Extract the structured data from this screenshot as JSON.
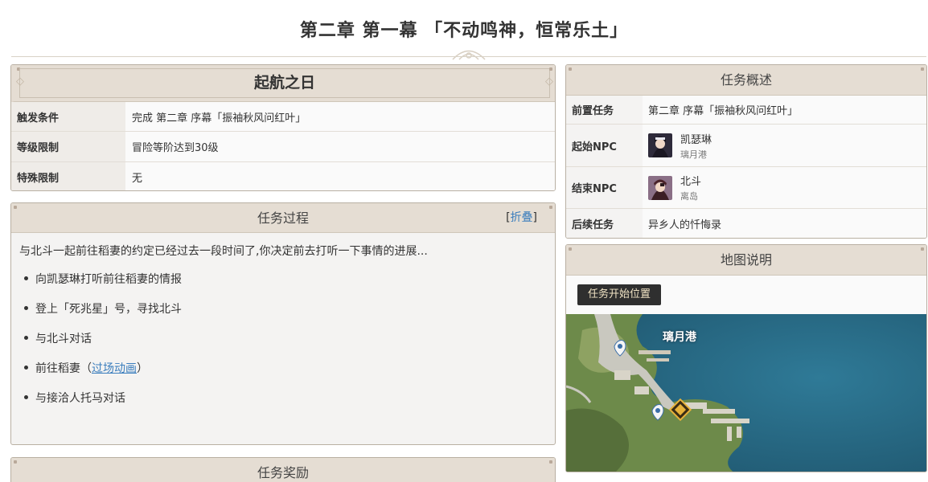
{
  "page": {
    "title": "第二章 第一幕 「不动鸣神，恒常乐土」"
  },
  "launch": {
    "title": "起航之日",
    "rows": [
      {
        "key": "触发条件",
        "value": "完成 第二章 序幕「振袖秋风问红叶」"
      },
      {
        "key": "等级限制",
        "value": "冒险等阶达到30级"
      },
      {
        "key": "特殊限制",
        "value": "无"
      }
    ]
  },
  "process": {
    "title": "任务过程",
    "fold_open": "[",
    "fold_label": "折叠",
    "fold_close": "]",
    "intro": "与北斗一起前往稻妻的约定已经过去一段时间了,你决定前去打听一下事情的进展...",
    "steps": [
      "向凯瑟琳打听前往稻妻的情报",
      "登上「死兆星」号，寻找北斗",
      "与北斗对话",
      "前往稻妻",
      "与接洽人托马对话"
    ],
    "step4_link_open": "（",
    "step4_link": "过场动画",
    "step4_link_close": "）"
  },
  "reward": {
    "title": "任务奖励"
  },
  "overview": {
    "title": "任务概述",
    "prev_key": "前置任务",
    "prev_value": "第二章 序幕「振袖秋风问红叶」",
    "start_key": "起始NPC",
    "start_npc": {
      "name": "凯瑟琳",
      "location": "璃月港"
    },
    "end_key": "结束NPC",
    "end_npc": {
      "name": "北斗",
      "location": "离岛"
    },
    "next_key": "后续任务",
    "next_value": "异乡人的忏悔录"
  },
  "map": {
    "title": "地图说明",
    "button": "任务开始位置",
    "place_label": "璃月港"
  },
  "colors": {
    "header_bg": "#e5ddd3",
    "link": "#3a7dbd",
    "map_water": "#2a6a86",
    "map_land": "#6d8a4a",
    "marker": "#e8b23a"
  }
}
